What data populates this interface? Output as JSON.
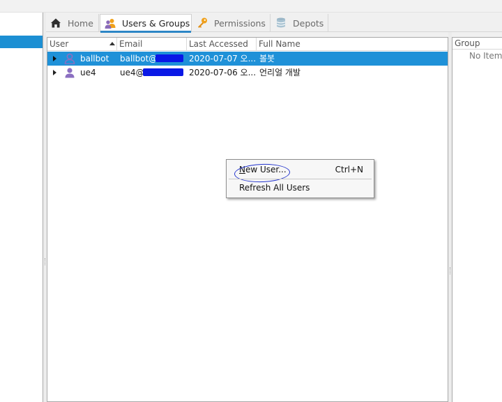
{
  "tabs": [
    {
      "label": "Home",
      "icon": "home-icon",
      "active": false
    },
    {
      "label": "Users & Groups",
      "icon": "users-groups-icon",
      "active": true
    },
    {
      "label": "Permissions",
      "icon": "key-icon",
      "active": false
    },
    {
      "label": "Depots",
      "icon": "database-icon",
      "active": false
    }
  ],
  "users_table": {
    "columns": [
      "User",
      "Email",
      "Last Accessed",
      "Full Name"
    ],
    "sort_column": "User",
    "sort_direction": "ascending",
    "rows": [
      {
        "user": "ballbot",
        "email": "ballbot@",
        "last_accessed": "2020-07-07 오...",
        "full_name": "볼봇",
        "selected": true
      },
      {
        "user": "ue4",
        "email": "ue4@",
        "last_accessed": "2020-07-06 오...",
        "full_name": "언리얼 개발",
        "selected": false
      }
    ]
  },
  "context_menu": {
    "items": [
      {
        "label_mnemonic": "N",
        "label_rest": "ew User...",
        "shortcut": "Ctrl+N",
        "annotated": true
      },
      {
        "label": "Refresh All Users"
      }
    ]
  },
  "groups_panel": {
    "header": "Group",
    "empty_text": "No Items"
  },
  "colors": {
    "selection": "#1f91d8",
    "accent": "#2d86c6",
    "redaction": "#0a18e6",
    "annotation": "#2233cc"
  }
}
